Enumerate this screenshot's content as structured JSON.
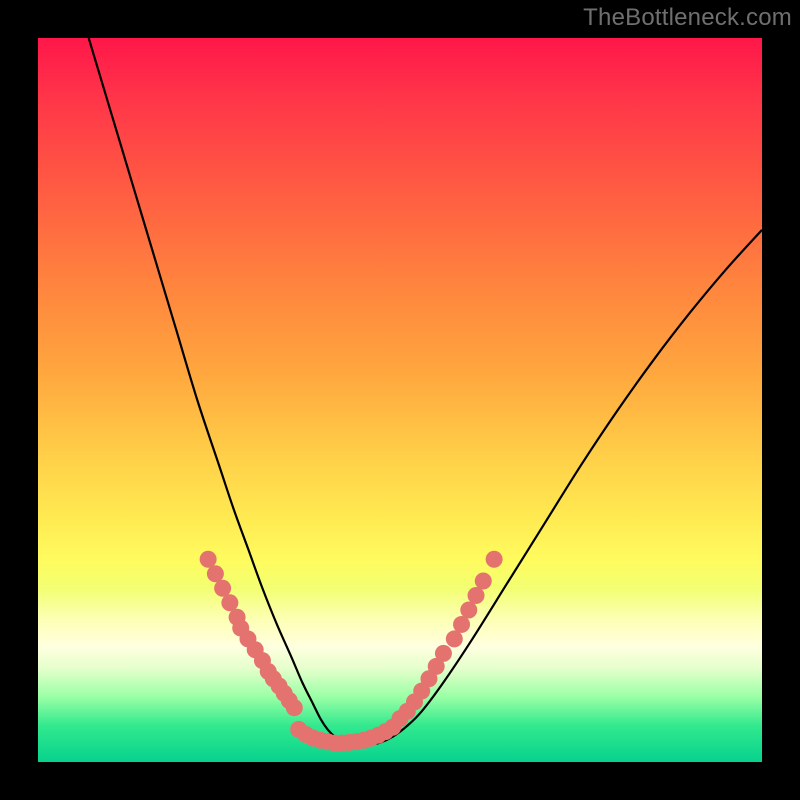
{
  "watermark": "TheBottleneck.com",
  "chart_data": {
    "type": "line",
    "title": "",
    "xlabel": "",
    "ylabel": "",
    "xlim": [
      0,
      100
    ],
    "ylim": [
      0,
      100
    ],
    "grid": false,
    "legend": false,
    "series": [
      {
        "name": "bottleneck-curve",
        "color": "#000000",
        "x": [
          7,
          10,
          13,
          16,
          19,
          22,
          25,
          27,
          29,
          31,
          33,
          35,
          36.5,
          38,
          39,
          40,
          41,
          42,
          43.5,
          45,
          47,
          49,
          51,
          53,
          56,
          60,
          65,
          70,
          75,
          80,
          85,
          90,
          95,
          100
        ],
        "y": [
          100,
          90,
          80,
          70,
          60,
          50,
          41,
          35,
          29.5,
          24,
          19,
          14.5,
          11,
          8,
          6,
          4.5,
          3.5,
          3,
          2.5,
          2.3,
          2.6,
          3.5,
          5,
          7,
          11,
          17,
          25,
          33,
          41,
          48.5,
          55.5,
          62,
          68,
          73.5
        ]
      },
      {
        "name": "highlight-dots-left",
        "color": "#e4736f",
        "x": [
          23.5,
          24.5,
          25.5,
          26.5,
          27.5,
          28,
          29,
          30,
          31,
          31.8,
          32.5,
          33.3,
          34,
          34.7,
          35.4
        ],
        "y": [
          28,
          26,
          24,
          22,
          20,
          18.5,
          17,
          15.5,
          14,
          12.5,
          11.5,
          10.5,
          9.5,
          8.5,
          7.5
        ]
      },
      {
        "name": "highlight-dots-bottom",
        "color": "#e4736f",
        "x": [
          36,
          37,
          38,
          39,
          40,
          41,
          42,
          43,
          44,
          45,
          46,
          47,
          48,
          49
        ],
        "y": [
          4.5,
          3.8,
          3.3,
          3.0,
          2.8,
          2.6,
          2.6,
          2.7,
          2.8,
          3.0,
          3.3,
          3.7,
          4.2,
          4.8
        ]
      },
      {
        "name": "highlight-dots-right",
        "color": "#e4736f",
        "x": [
          50,
          51,
          52,
          53,
          54,
          55,
          56,
          57.5,
          58.5,
          59.5,
          60.5,
          61.5,
          63
        ],
        "y": [
          6,
          7,
          8.3,
          9.8,
          11.5,
          13.2,
          15,
          17,
          19,
          21,
          23,
          25,
          28
        ]
      }
    ],
    "gradient_stops": [
      {
        "pos": 0.0,
        "color": "#ff1749"
      },
      {
        "pos": 0.08,
        "color": "#ff3449"
      },
      {
        "pos": 0.22,
        "color": "#ff5f42"
      },
      {
        "pos": 0.34,
        "color": "#ff843e"
      },
      {
        "pos": 0.46,
        "color": "#ffa63e"
      },
      {
        "pos": 0.58,
        "color": "#ffd048"
      },
      {
        "pos": 0.66,
        "color": "#ffe951"
      },
      {
        "pos": 0.72,
        "color": "#fffb5e"
      },
      {
        "pos": 0.76,
        "color": "#f3ff72"
      },
      {
        "pos": 0.8,
        "color": "#fbffb0"
      },
      {
        "pos": 0.82,
        "color": "#ffffc7"
      },
      {
        "pos": 0.84,
        "color": "#ffffe0"
      },
      {
        "pos": 0.87,
        "color": "#e6ffcc"
      },
      {
        "pos": 0.91,
        "color": "#9affa6"
      },
      {
        "pos": 0.95,
        "color": "#32e98e"
      },
      {
        "pos": 1.0,
        "color": "#06d28e"
      }
    ]
  }
}
